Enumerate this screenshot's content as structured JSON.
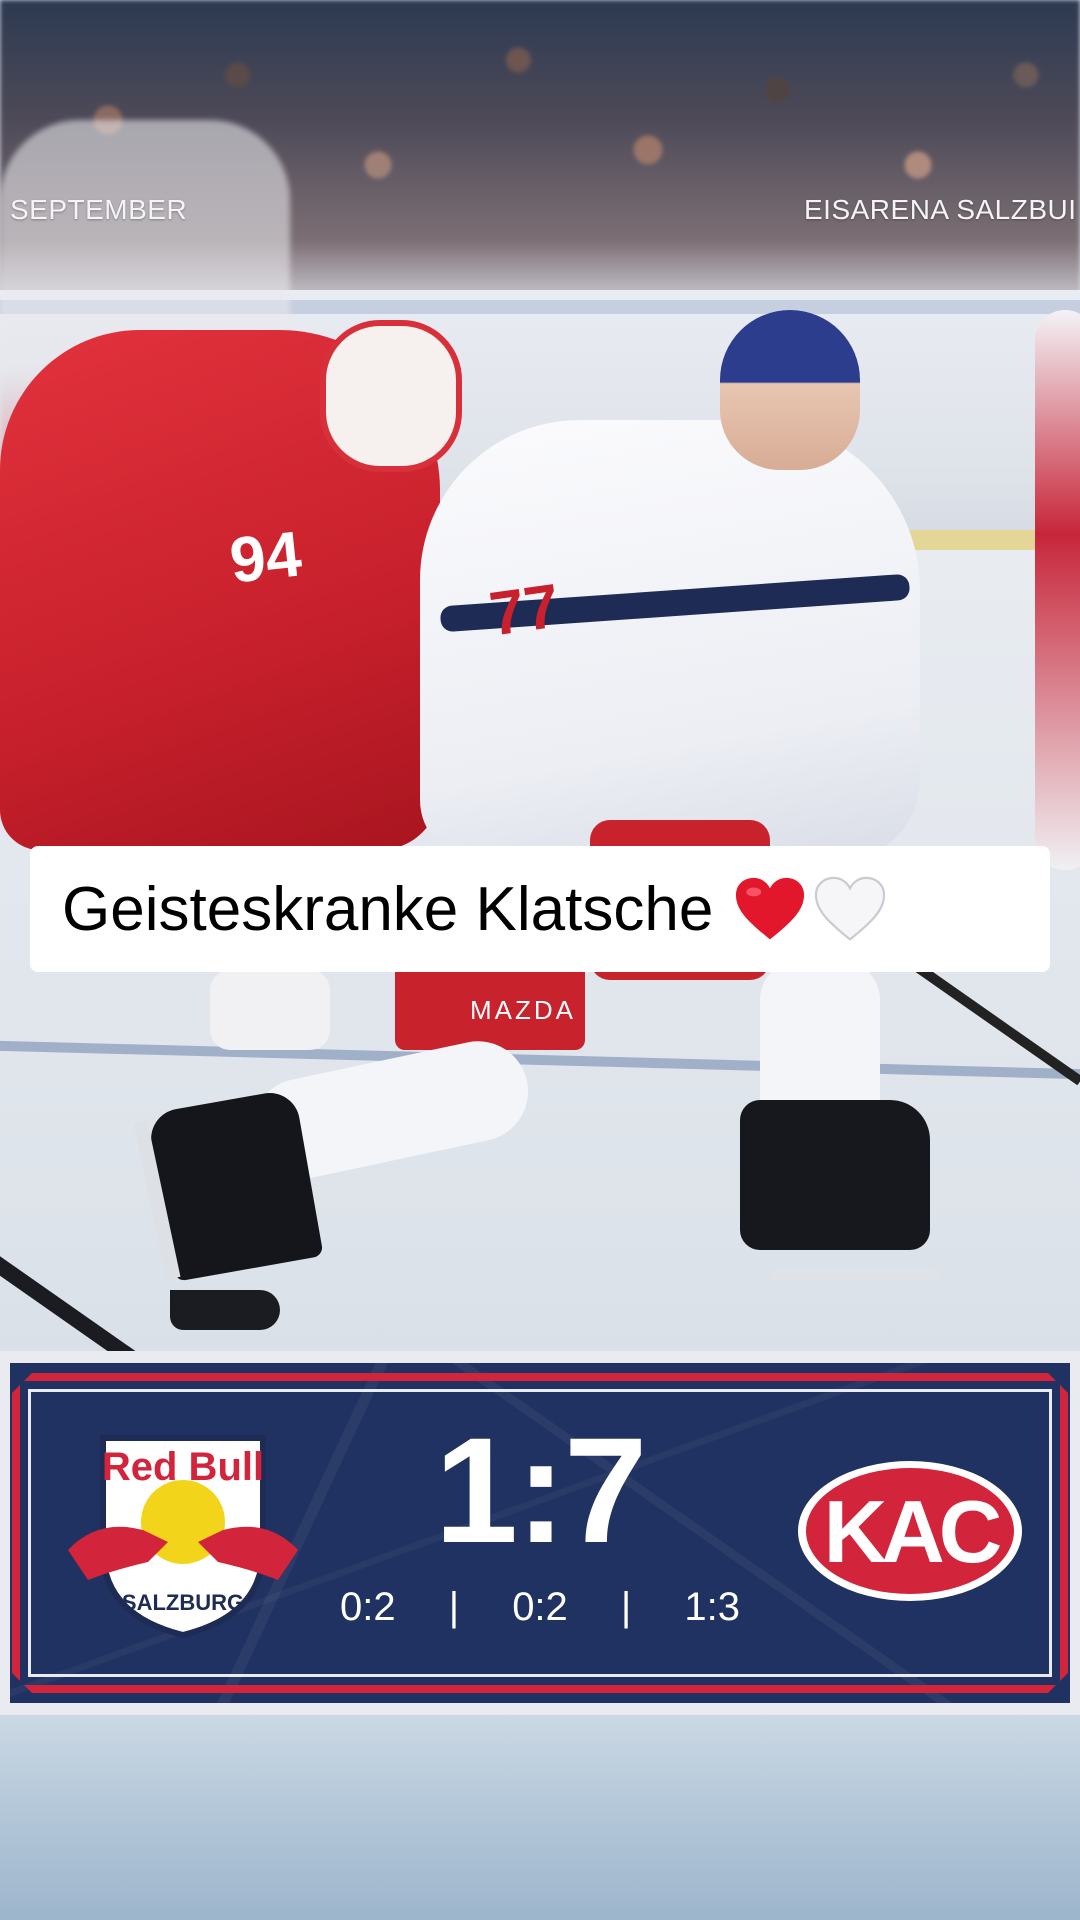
{
  "photo": {
    "left_label": "SEPTEMBER",
    "right_label": "EISARENA SALZBUI",
    "player_red_number": "94",
    "player_white_number": "77",
    "sponsor": "MAZDA"
  },
  "caption": {
    "text": "Geisteskranke Klatsche",
    "emoji_1": "red-heart",
    "emoji_2": "white-heart"
  },
  "scoreboard": {
    "home_team_logo_text": "Red Bull",
    "home_team_logo_subtext": "SALZBURG",
    "away_team_logo_text": "KAC",
    "final_score": "1:7",
    "periods": [
      "0:2",
      "0:2",
      "1:3"
    ],
    "separator": "|",
    "colors": {
      "panel": "#203261",
      "frame": "#d2253c",
      "kac_red": "#d2253c"
    }
  }
}
